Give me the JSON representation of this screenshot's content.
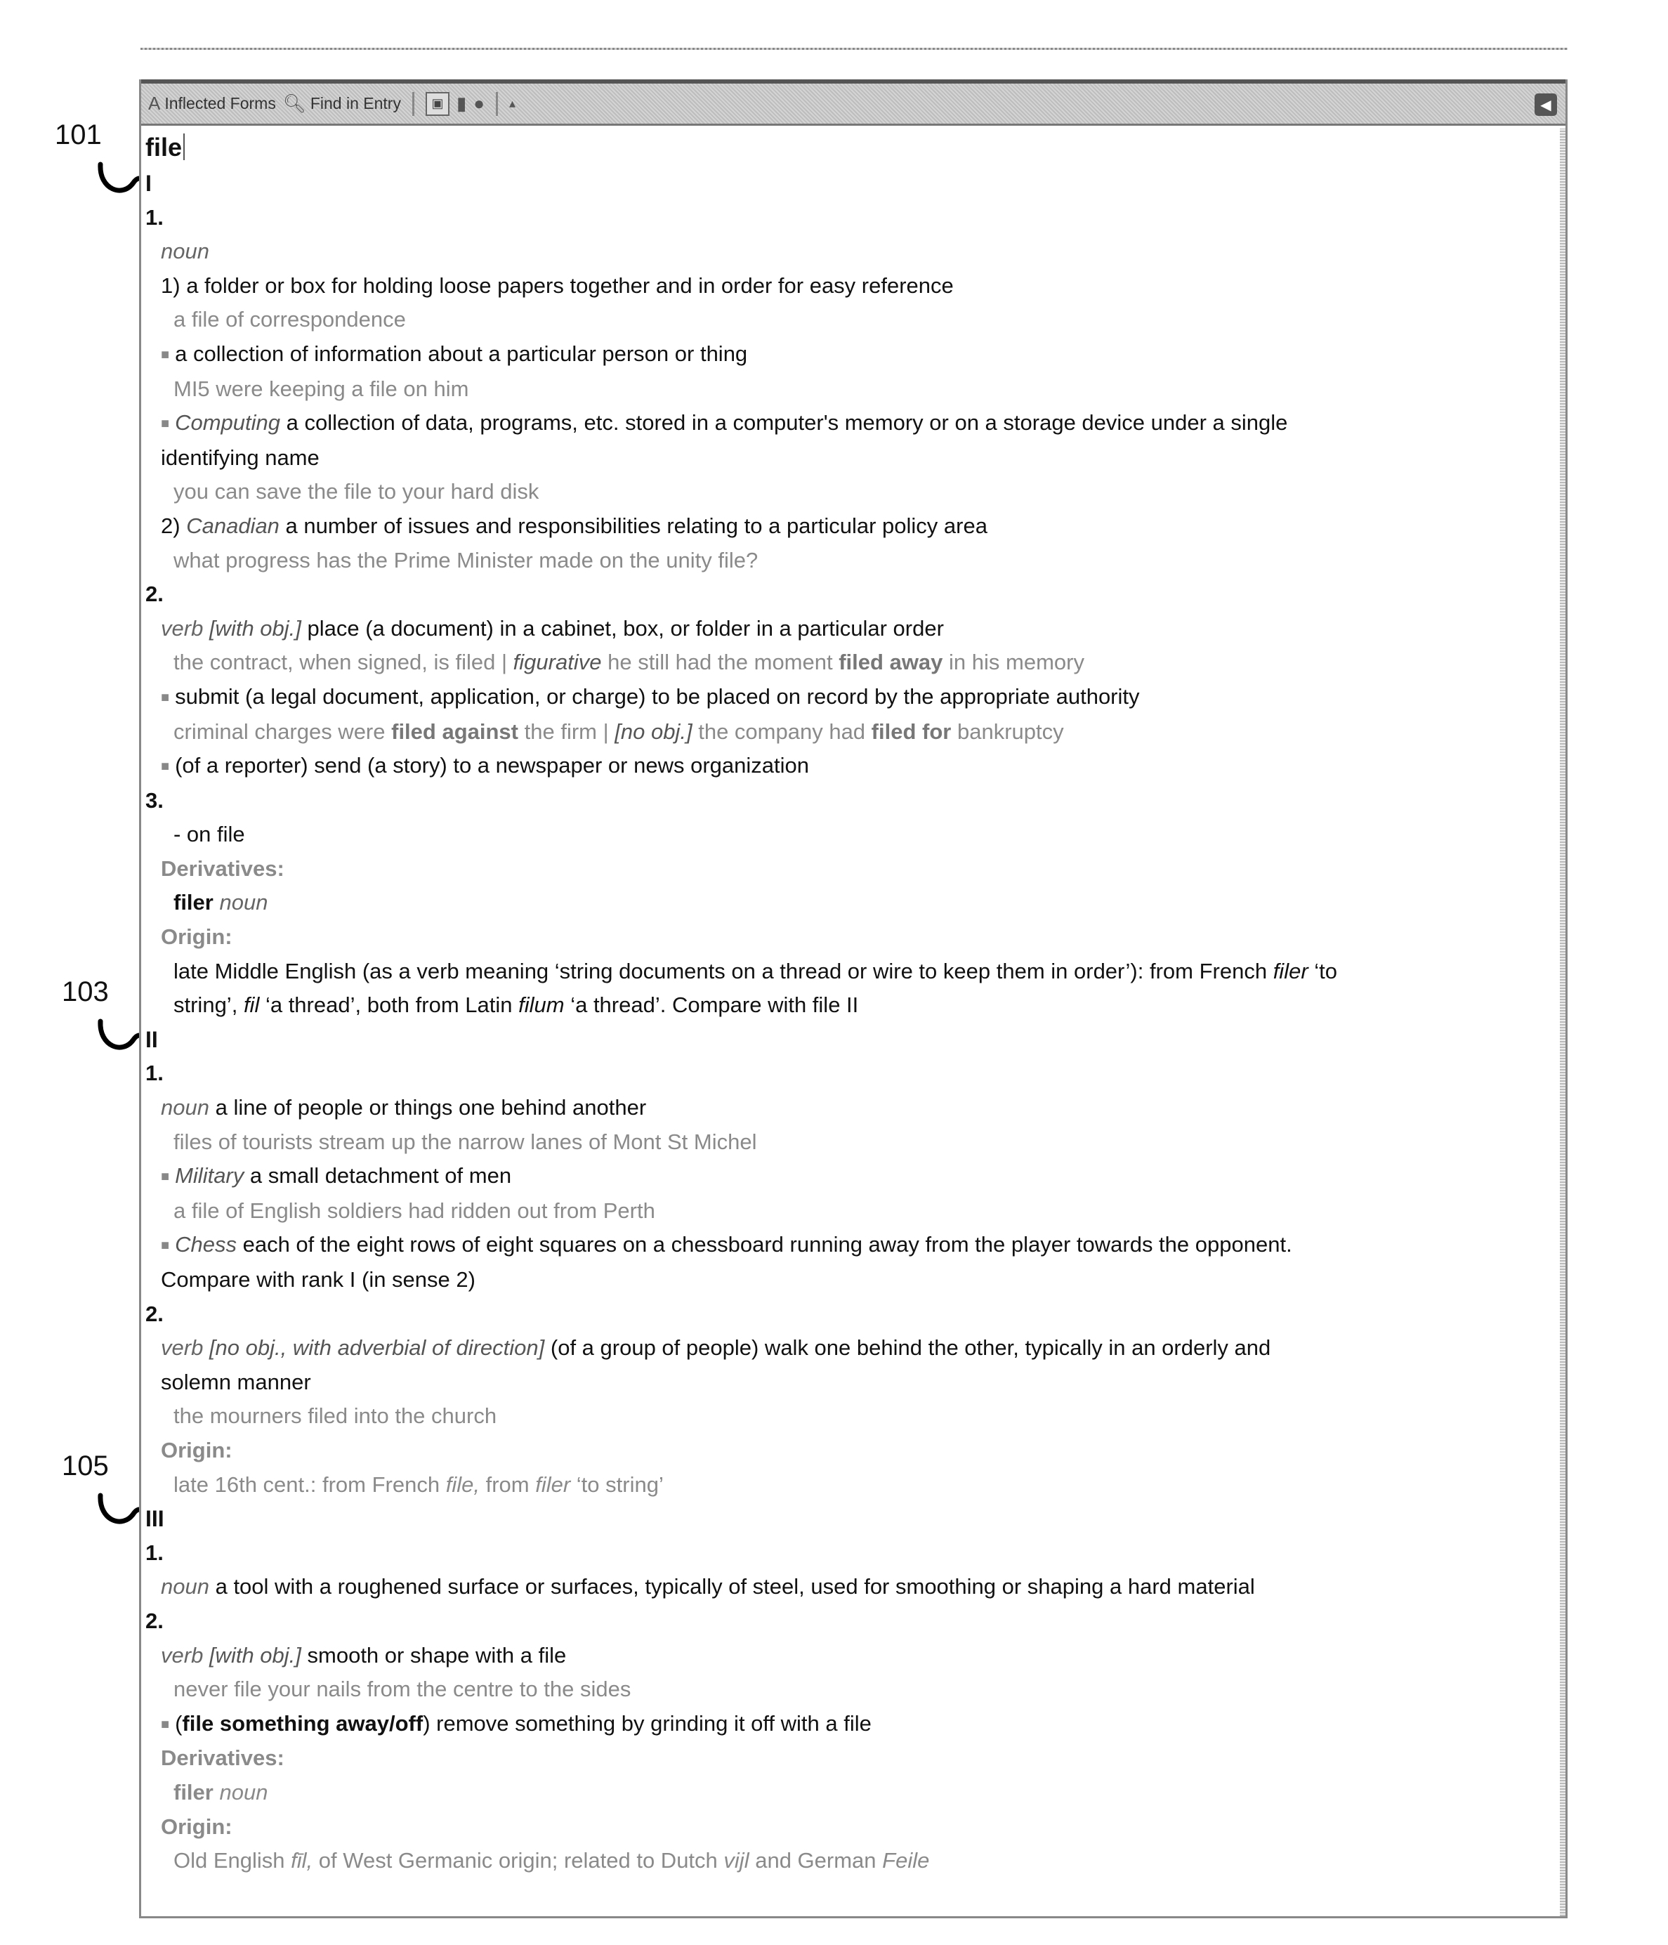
{
  "toolbar": {
    "inflected_forms": "Inflected Forms",
    "find_in_entry": "Find in Entry",
    "icons": [
      "letter-a-icon",
      "binoculars-icon",
      "view-icon",
      "book-icon",
      "mortarboard-icon",
      "speaker-icon",
      "back-icon"
    ]
  },
  "ref_labels": {
    "a": "101",
    "b": "103",
    "c": "105"
  },
  "entry": {
    "headword": "file",
    "h1": {
      "numeral": "I",
      "s1": {
        "num": "1.",
        "pos": "noun",
        "d1_num": "1)",
        "d1": "a folder or box for holding loose papers together and in order for easy reference",
        "d1_ex": "a file of correspondence",
        "d2": "a collection of information about a particular person or thing",
        "d2_ex": "MI5 were keeping a file on him",
        "d3_label": "Computing",
        "d3": "a collection of data, programs, etc. stored in a computer's memory or on a storage device under a single",
        "d3_cont": "identifying name",
        "d3_ex": "you can save the file to your hard disk",
        "d4_num": "2)",
        "d4_label": "Canadian",
        "d4": "a number of issues and responsibilities relating to a particular policy area",
        "d4_ex": "what progress has the Prime Minister made on the unity file?"
      },
      "s2": {
        "num": "2.",
        "pos": "verb",
        "gram": "[with obj.]",
        "d1": "place (a document) in a cabinet, box, or folder in a particular order",
        "d1_ex_a": "the contract, when signed, is filed |",
        "d1_ex_lab": "figurative",
        "d1_ex_b": "he still had the moment",
        "d1_ex_bold": "filed away",
        "d1_ex_c": "in his memory",
        "d2": "submit (a legal document, application, or charge) to be placed on record by the appropriate authority",
        "d2_ex_a": "criminal charges were",
        "d2_ex_bold1": "filed against",
        "d2_ex_b": "the firm |",
        "d2_ex_lab": "[no obj.]",
        "d2_ex_c": "the company had",
        "d2_ex_bold2": "filed for",
        "d2_ex_d": "bankruptcy",
        "d3": "(of a reporter) send (a story) to a newspaper or news organization"
      },
      "s3": {
        "num": "3.",
        "phrase": "- on file"
      },
      "derivatives_label": "Derivatives:",
      "derivative_word": "filer",
      "derivative_pos": "noun",
      "origin_label": "Origin:",
      "origin_a": "late Middle English (as a verb meaning ‘string documents on a thread or wire to keep them in order’): from French",
      "origin_filer": "filer",
      "origin_b": "‘to",
      "origin_c": "string’,",
      "origin_fil": "fil",
      "origin_d": "‘a thread’, both from Latin",
      "origin_filum": "filum",
      "origin_e": "‘a thread’. Compare with file II"
    },
    "h2": {
      "numeral": "II",
      "s1": {
        "num": "1.",
        "pos": "noun",
        "d1": "a line of people or things one behind another",
        "d1_ex": "files of tourists stream up the narrow lanes of Mont St Michel",
        "d2_label": "Military",
        "d2": "a small detachment of men",
        "d2_ex": "a file of English soldiers had ridden out from Perth",
        "d3_label": "Chess",
        "d3": "each of the eight rows of eight squares on a chessboard running away from the player towards the opponent.",
        "d3_cont": "Compare with rank I (in sense 2)"
      },
      "s2": {
        "num": "2.",
        "pos": "verb",
        "gram": "[no obj., with adverbial of direction]",
        "d1": "(of a group of people) walk one behind the other, typically in an orderly and",
        "d1_cont": "solemn manner",
        "d1_ex": "the mourners filed into the church"
      },
      "origin_label": "Origin:",
      "origin_a": "late 16th cent.: from French",
      "origin_file": "file,",
      "origin_b": "from",
      "origin_filer": "filer",
      "origin_c": "‘to string’"
    },
    "h3": {
      "numeral": "III",
      "s1": {
        "num": "1.",
        "pos": "noun",
        "d1": "a tool with a roughened surface or surfaces, typically of steel, used for smoothing or shaping a hard material"
      },
      "s2": {
        "num": "2.",
        "pos": "verb",
        "gram": "[with obj.]",
        "d1": "smooth or shape with a file",
        "d1_ex": "never file your nails from the centre to the sides",
        "d2_open": "(",
        "d2_bold": "file something away/off",
        "d2": ") remove something by grinding it off with a file"
      },
      "derivatives_label": "Derivatives:",
      "derivative_word": "filer",
      "derivative_pos": "noun",
      "origin_label": "Origin:",
      "origin_a": "Old English",
      "origin_fil": "fīl,",
      "origin_b": "of West Germanic origin; related to Dutch",
      "origin_vijl": "vijl",
      "origin_c": "and German",
      "origin_feile": "Feile"
    }
  }
}
